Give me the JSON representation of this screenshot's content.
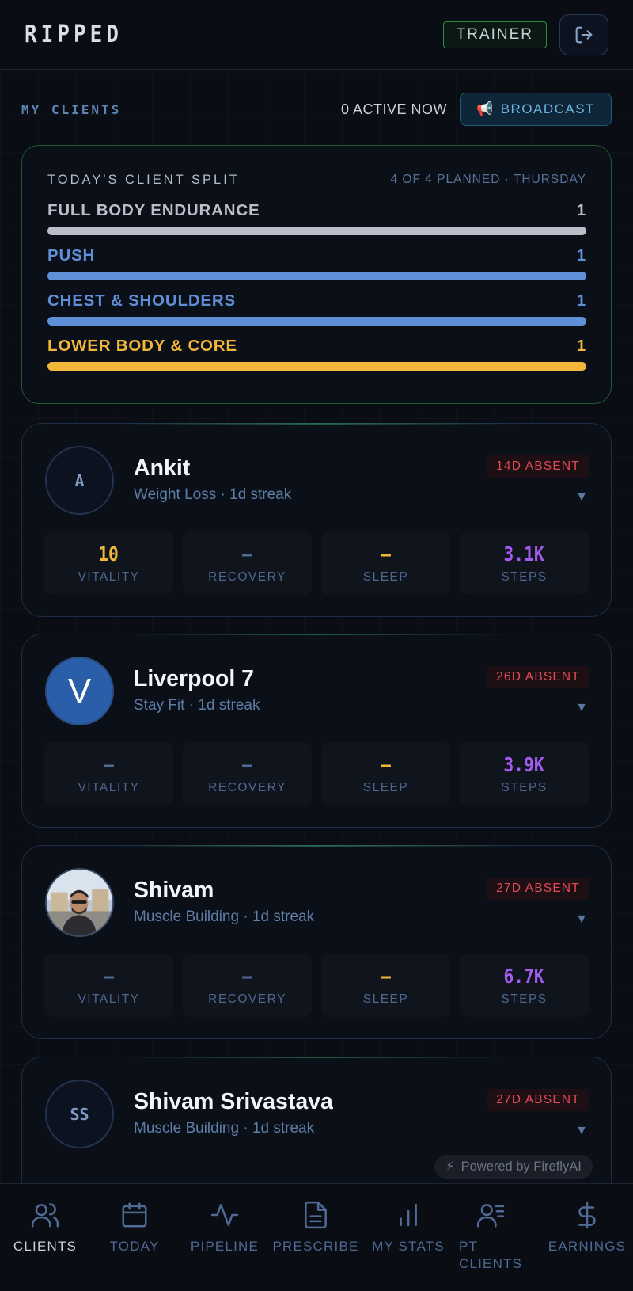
{
  "app": {
    "logo": "RIPPED",
    "role": "TRAINER"
  },
  "section": {
    "title": "MY CLIENTS",
    "active_now": "0 ACTIVE NOW",
    "broadcast_icon": "📢",
    "broadcast_label": "BROADCAST"
  },
  "split": {
    "title": "TODAY'S CLIENT SPLIT",
    "meta": "4 OF 4 PLANNED · THURSDAY",
    "rows": [
      {
        "name": "FULL BODY ENDURANCE",
        "count": "1",
        "fill": 1.0,
        "color": "#b9bec8"
      },
      {
        "name": "PUSH",
        "count": "1",
        "fill": 1.0,
        "color": "#5f8fd6"
      },
      {
        "name": "CHEST & SHOULDERS",
        "count": "1",
        "fill": 1.0,
        "color": "#5f8fd6"
      },
      {
        "name": "LOWER BODY & CORE",
        "count": "1",
        "fill": 1.0,
        "color": "#f2b73a"
      }
    ]
  },
  "clients": [
    {
      "initial": "A",
      "name": "Ankit",
      "sub": "Weight Loss · 1d streak",
      "absent": "14D ABSENT",
      "chevron": "▼",
      "metrics": [
        {
          "value": "10",
          "label": "VITALITY",
          "color": "#f2b73a"
        },
        {
          "value": "–",
          "label": "RECOVERY",
          "color": "#4e6a95"
        },
        {
          "value": "–",
          "label": "SLEEP",
          "color": "#f2b73a"
        },
        {
          "value": "3.1K",
          "label": "STEPS",
          "color": "#a45cf0"
        }
      ]
    },
    {
      "initial": "V",
      "name": "Liverpool 7",
      "sub": "Stay Fit · 1d streak",
      "absent": "26D ABSENT",
      "chevron": "▼",
      "metrics": [
        {
          "value": "–",
          "label": "VITALITY",
          "color": "#4e6a95"
        },
        {
          "value": "–",
          "label": "RECOVERY",
          "color": "#4e6a95"
        },
        {
          "value": "–",
          "label": "SLEEP",
          "color": "#f2b73a"
        },
        {
          "value": "3.9K",
          "label": "STEPS",
          "color": "#a45cf0"
        }
      ]
    },
    {
      "initial": "",
      "name": "Shivam",
      "sub": "Muscle Building · 1d streak",
      "absent": "27D ABSENT",
      "chevron": "▼",
      "metrics": [
        {
          "value": "–",
          "label": "VITALITY",
          "color": "#4e6a95"
        },
        {
          "value": "–",
          "label": "RECOVERY",
          "color": "#4e6a95"
        },
        {
          "value": "–",
          "label": "SLEEP",
          "color": "#f2b73a"
        },
        {
          "value": "6.7K",
          "label": "STEPS",
          "color": "#a45cf0"
        }
      ]
    },
    {
      "initial": "SS",
      "name": "Shivam Srivastava",
      "sub": "Muscle Building · 1d streak",
      "absent": "27D ABSENT",
      "chevron": "▼",
      "metrics": []
    }
  ],
  "powered_by": {
    "icon": "⚡",
    "text": "Powered by FireflyAI"
  },
  "nav": [
    {
      "label": "CLIENTS",
      "icon": "users-icon"
    },
    {
      "label": "TODAY",
      "icon": "calendar-icon"
    },
    {
      "label": "PIPELINE",
      "icon": "activity-icon"
    },
    {
      "label": "PRESCRIBE",
      "icon": "document-icon"
    },
    {
      "label": "MY STATS",
      "icon": "bar-chart-icon"
    },
    {
      "label": "PT CLIENTS",
      "icon": "user-list-icon"
    },
    {
      "label": "EARNINGS",
      "icon": "dollar-icon"
    }
  ],
  "colors": {
    "accent_green": "#2f8a4a",
    "absent_red": "#e04b55",
    "steps_purple": "#a45cf0",
    "amber": "#f2b73a",
    "blue": "#5f8fd6"
  }
}
